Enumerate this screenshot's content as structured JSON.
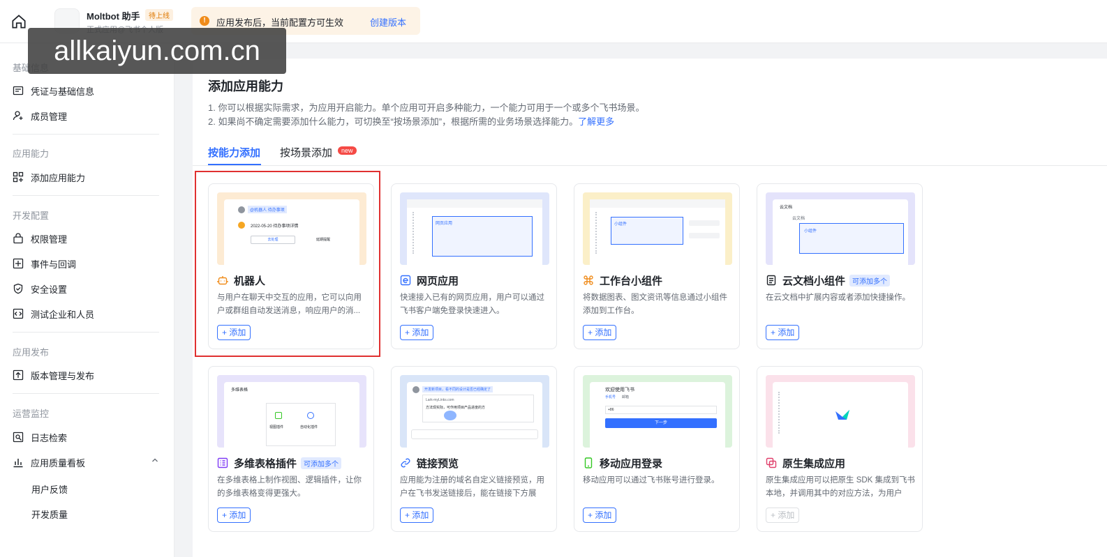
{
  "header": {
    "app_name": "Moltbot 助手",
    "status_tag": "待上线",
    "app_subtitle": "正式应用@飞书个人版",
    "notice_text": "应用发布后，当前配置方可生效",
    "notice_link": "创建版本"
  },
  "watermark": "allkaiyun.com.cn",
  "sidebar": {
    "groups": [
      "基础信息",
      "应用能力",
      "开发配置",
      "应用发布",
      "运营监控"
    ],
    "items": {
      "credentials": "凭证与基础信息",
      "members": "成员管理",
      "add_capability": "添加应用能力",
      "permissions": "权限管理",
      "events": "事件与回调",
      "security": "安全设置",
      "test_enterprise": "测试企业和人员",
      "version": "版本管理与发布",
      "logs": "日志检索",
      "quality": "应用质量看板",
      "feedback": "用户反馈",
      "dev_quality": "开发质量"
    }
  },
  "main": {
    "title": "添加应用能力",
    "desc1": "1. 你可以根据实际需求，为应用开启能力。单个应用可开启多种能力，一个能力可用于一个或多个飞书场景。",
    "desc2": "2. 如果尚不确定需要添加什么能力，可切换至“按场景添加”，根据所需的业务场景选择能力。",
    "learn_more": "了解更多",
    "tabs": [
      "按能力添加",
      "按场景添加"
    ],
    "new_badge": "new",
    "add_label": "+ 添加",
    "multi_tag": "可添加多个",
    "cards": [
      {
        "title": "机器人",
        "desc": "与用户在聊天中交互的应用，它可以向用户或群组自动发送消息，响应用户的消...",
        "icon": "robot-icon",
        "thumb_color": "#fdebd3"
      },
      {
        "title": "网页应用",
        "desc": "快速接入已有的网页应用，用户可以通过飞书客户端免登录快速进入。",
        "icon": "web-app-icon",
        "thumb_color": "#dfe6fb"
      },
      {
        "title": "工作台小组件",
        "desc": "将数据图表、图文资讯等信息通过小组件添加到工作台。",
        "icon": "widget-icon",
        "thumb_color": "#fbefc8"
      },
      {
        "title": "云文档小组件",
        "desc": "在云文档中扩展内容或者添加快捷操作。",
        "icon": "doc-icon",
        "thumb_color": "#e4e3fb"
      },
      {
        "title": "多维表格插件",
        "desc": "在多维表格上制作视图、逻辑插件，让你的多维表格变得更强大。",
        "icon": "bitable-icon",
        "thumb_color": "#e7e3fb"
      },
      {
        "title": "链接预览",
        "desc": "应用能为注册的域名自定义链接预览，用户在飞书发送链接后，能在链接下方展示...",
        "icon": "link-icon",
        "thumb_color": "#d9e5f8"
      },
      {
        "title": "移动应用登录",
        "desc": "移动应用可以通过飞书账号进行登录。",
        "icon": "mobile-icon",
        "thumb_color": "#dcf3dc"
      },
      {
        "title": "原生集成应用",
        "desc": "原生集成应用可以把原生 SDK 集成到飞书本地，并调用其中的对应方法，为用户提...",
        "icon": "native-icon",
        "thumb_color": "#fbe1ea"
      }
    ],
    "thumb_texts": {
      "robot_tag": "@机器人 待办事项",
      "robot_date": "2022-05-20 待办事项详情",
      "robot_btn1": "去处理",
      "robot_btn2": "延期提醒",
      "webapp": "网页应用",
      "widget": "小组件",
      "doc_head": "云文档",
      "doc_sub": "云文档",
      "doc_widget": "小组件",
      "bitable_head": "多维表格",
      "bitable_view": "视图插件",
      "bitable_auto": "自动化插件",
      "link_msg": "开发新项目，看不同的设计是否已经确定了",
      "link_url": "Lark-myLinks.com",
      "link_reply": "方法现实际，可作用项目产品进度的方",
      "mobile_title": "欢迎使用飞书",
      "mobile_tab1": "手机号",
      "mobile_tab2": "邮箱",
      "mobile_code": "+86",
      "mobile_btn": "下一步"
    }
  }
}
